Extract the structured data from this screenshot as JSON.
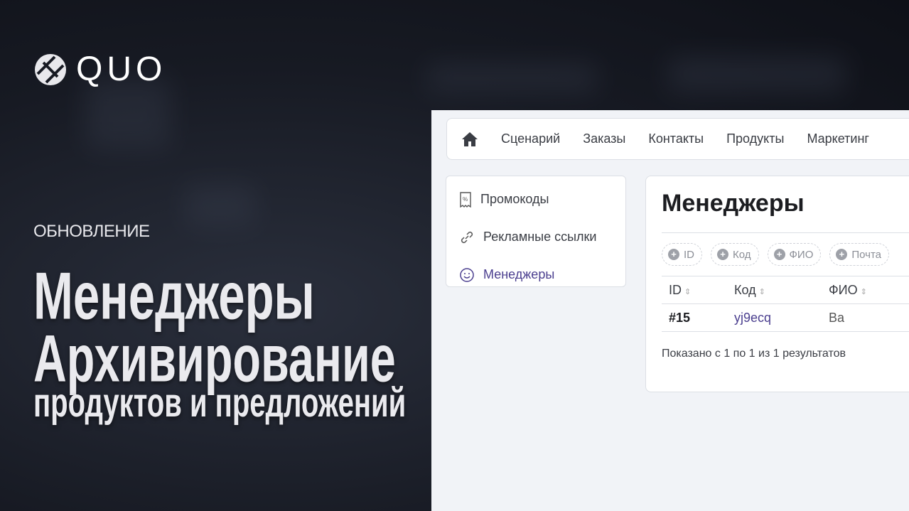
{
  "brand": {
    "name": "QUO"
  },
  "promo": {
    "kicker": "ОБНОВЛЕНИЕ",
    "line1": "Менеджеры",
    "line2": "Архивирование",
    "line3": "продуктов и предложений"
  },
  "nav": {
    "items": [
      "Сценарий",
      "Заказы",
      "Контакты",
      "Продукты",
      "Маркетинг"
    ]
  },
  "sidebar": {
    "items": [
      {
        "label": "Промокоды",
        "icon": "receipt-percent-icon"
      },
      {
        "label": "Рекламные ссылки",
        "icon": "link-icon"
      },
      {
        "label": "Менеджеры",
        "icon": "smile-icon",
        "active": true
      }
    ]
  },
  "main": {
    "title": "Менеджеры",
    "filters": [
      "ID",
      "Код",
      "ФИО",
      "Почта"
    ],
    "columns": [
      "ID",
      "Код",
      "ФИО"
    ],
    "rows": [
      {
        "id": "#15",
        "code": "yj9ecq",
        "name": "Ва"
      }
    ],
    "footer": "Показано с 1 по 1 из 1 результатов"
  },
  "colors": {
    "accent": "#4b3f8f",
    "panel_bg": "#f1f3f7"
  }
}
